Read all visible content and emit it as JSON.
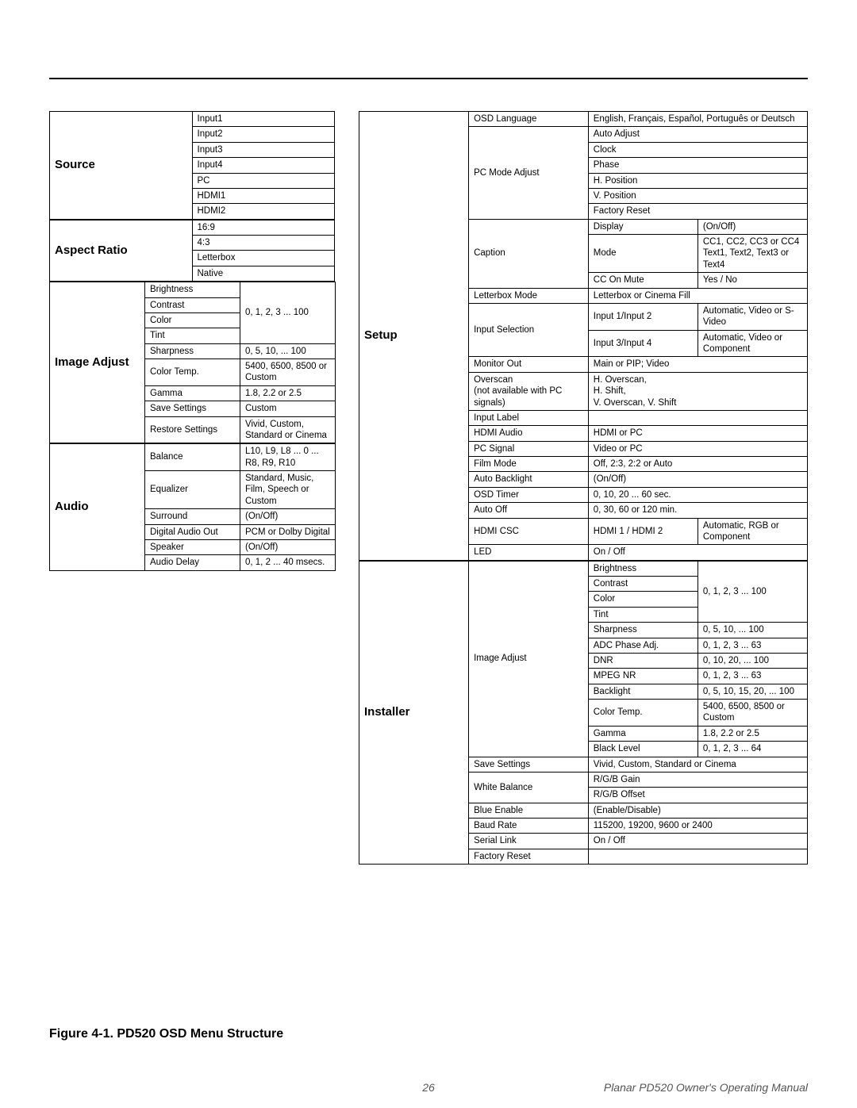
{
  "caption": "Figure 4-1. PD520 OSD Menu Structure",
  "page_number": "26",
  "footer": "Planar PD520 Owner's Operating Manual",
  "left_tables": [
    {
      "section": "Source",
      "cols": [
        120,
        120
      ],
      "rows": [
        [
          "Input1"
        ],
        [
          "Input2"
        ],
        [
          "Input3"
        ],
        [
          "Input4"
        ],
        [
          "PC"
        ],
        [
          "HDMI1"
        ],
        [
          "HDMI2"
        ]
      ]
    },
    {
      "section": "Aspect Ratio",
      "cols": [
        120,
        120
      ],
      "rows": [
        [
          "16:9"
        ],
        [
          "4:3"
        ],
        [
          "Letterbox"
        ],
        [
          "Native"
        ]
      ]
    },
    {
      "section": "Image Adjust",
      "cols": [
        120,
        120,
        120
      ],
      "rows": [
        [
          "Brightness",
          {
            "text": "0, 1, 2, 3 ... 100",
            "rowspan": 4
          }
        ],
        [
          "Contrast"
        ],
        [
          "Color"
        ],
        [
          "Tint"
        ],
        [
          "Sharpness",
          "0, 5, 10, ... 100"
        ],
        [
          "Color Temp.",
          "5400, 6500, 8500 or Custom"
        ],
        [
          "Gamma",
          "1.8, 2.2 or 2.5"
        ],
        [
          "Save Settings",
          "Custom"
        ],
        [
          "Restore Settings",
          "Vivid, Custom, Standard or Cinema"
        ]
      ]
    },
    {
      "section": "Audio",
      "cols": [
        120,
        120,
        120
      ],
      "rows": [
        [
          "Balance",
          "L10, L9, L8 ... 0 ... R8, R9, R10"
        ],
        [
          "Equalizer",
          "Standard, Music, Film, Speech or Custom"
        ],
        [
          "Surround",
          "(On/Off)"
        ],
        [
          "Digital Audio Out",
          "PCM or Dolby Digital"
        ],
        [
          "Speaker",
          "(On/Off)"
        ],
        [
          "Audio Delay",
          "0, 1, 2 ... 40 msecs."
        ]
      ]
    }
  ],
  "right_tables": [
    {
      "section": "Setup",
      "cols": [
        110,
        120,
        110,
        110
      ],
      "rows": [
        [
          "OSD Language",
          {
            "text": "English, Français, Español, Português or Deutsch",
            "colspan": 2
          }
        ],
        [
          {
            "text": "PC Mode Adjust",
            "rowspan": 6
          },
          {
            "text": "Auto Adjust",
            "colspan": 2
          }
        ],
        [
          {
            "text": "Clock",
            "colspan": 2
          }
        ],
        [
          {
            "text": "Phase",
            "colspan": 2
          }
        ],
        [
          {
            "text": "H. Position",
            "colspan": 2
          }
        ],
        [
          {
            "text": "V. Position",
            "colspan": 2
          }
        ],
        [
          {
            "text": "Factory Reset",
            "colspan": 2
          }
        ],
        [
          {
            "text": "Caption",
            "rowspan": 3
          },
          "Display",
          "(On/Off)"
        ],
        [
          "Mode",
          "CC1, CC2, CC3 or CC4\nText1, Text2, Text3 or Text4"
        ],
        [
          "CC On Mute",
          "Yes / No"
        ],
        [
          "Letterbox Mode",
          {
            "text": "Letterbox or Cinema Fill",
            "colspan": 2
          }
        ],
        [
          {
            "text": "Input Selection",
            "rowspan": 2
          },
          "Input 1/Input 2",
          "Automatic, Video or S-Video"
        ],
        [
          "Input 3/Input 4",
          "Automatic, Video or Component"
        ],
        [
          "Monitor Out",
          {
            "text": "Main or PIP; Video",
            "colspan": 2
          }
        ],
        [
          "Overscan\n(not available with PC signals)",
          {
            "text": "H. Overscan,\nH. Shift,\nV. Overscan, V. Shift",
            "colspan": 2
          }
        ],
        [
          "Input Label",
          {
            "text": "",
            "colspan": 2
          }
        ],
        [
          "HDMI Audio",
          {
            "text": "HDMI or PC",
            "colspan": 2
          }
        ],
        [
          "PC Signal",
          {
            "text": "Video or PC",
            "colspan": 2
          }
        ],
        [
          "Film Mode",
          {
            "text": "Off, 2:3, 2:2 or Auto",
            "colspan": 2
          }
        ],
        [
          "Auto Backlight",
          {
            "text": "(On/Off)",
            "colspan": 2
          }
        ],
        [
          "OSD Timer",
          {
            "text": "0, 10, 20 ... 60 sec.",
            "colspan": 2
          }
        ],
        [
          "Auto Off",
          {
            "text": "0, 30, 60 or 120 min.",
            "colspan": 2
          }
        ],
        [
          "HDMI CSC",
          "HDMI 1 / HDMI 2",
          "Automatic, RGB or Component"
        ],
        [
          "LED",
          {
            "text": "On / Off",
            "colspan": 2
          }
        ]
      ]
    },
    {
      "section": "Installer",
      "cols": [
        110,
        120,
        110,
        110
      ],
      "rows": [
        [
          {
            "text": "Image Adjust",
            "rowspan": 12
          },
          "Brightness",
          {
            "text": "0, 1, 2, 3 ... 100",
            "rowspan": 4
          }
        ],
        [
          "Contrast"
        ],
        [
          "Color"
        ],
        [
          "Tint"
        ],
        [
          "Sharpness",
          "0, 5, 10, ... 100"
        ],
        [
          "ADC Phase Adj.",
          "0, 1, 2, 3 ... 63"
        ],
        [
          "DNR",
          "0, 10, 20, ... 100"
        ],
        [
          "MPEG NR",
          "0, 1, 2, 3 ... 63"
        ],
        [
          "Backlight",
          "0, 5, 10, 15, 20, ... 100"
        ],
        [
          "Color Temp.",
          "5400, 6500, 8500 or Custom"
        ],
        [
          "Gamma",
          "1.8, 2.2 or 2.5"
        ],
        [
          "Black Level",
          "0, 1, 2, 3 ... 64"
        ],
        [
          "Save Settings",
          {
            "text": "Vivid, Custom, Standard or Cinema",
            "colspan": 2
          }
        ],
        [
          {
            "text": "White Balance",
            "rowspan": 2
          },
          {
            "text": "R/G/B Gain",
            "colspan": 2
          }
        ],
        [
          {
            "text": "R/G/B Offset",
            "colspan": 2
          }
        ],
        [
          "Blue Enable",
          {
            "text": "(Enable/Disable)",
            "colspan": 2
          }
        ],
        [
          "Baud Rate",
          {
            "text": "115200, 19200, 9600 or 2400",
            "colspan": 2
          }
        ],
        [
          "Serial Link",
          {
            "text": "On / Off",
            "colspan": 2
          }
        ],
        [
          "Factory Reset",
          {
            "text": "",
            "colspan": 2
          }
        ]
      ]
    }
  ]
}
